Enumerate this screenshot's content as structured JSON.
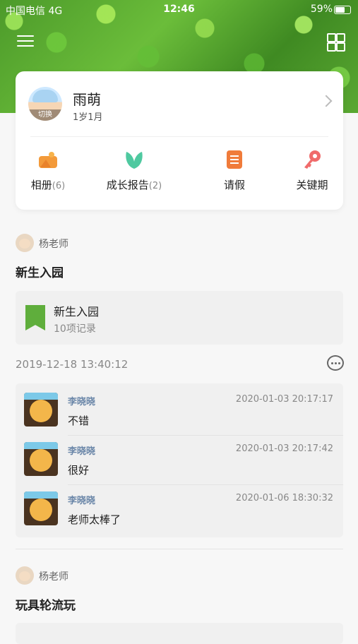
{
  "status_bar": {
    "carrier": "中国电信 4G",
    "time": "12:46",
    "battery": "59%"
  },
  "child": {
    "name": "雨萌",
    "age": "1岁1月",
    "switch_label": "切换"
  },
  "features": [
    {
      "label": "相册",
      "count": "(6)",
      "icon": "photo-album-icon",
      "color": "#f39a3a"
    },
    {
      "label": "成长报告",
      "count": "(2)",
      "icon": "growth-leaf-icon",
      "color": "#4fc9a0"
    },
    {
      "label": "请假",
      "count": "",
      "icon": "leave-document-icon",
      "color": "#f07b3a"
    },
    {
      "label": "关键期",
      "count": "",
      "icon": "key-icon",
      "color": "#f06b6b"
    }
  ],
  "posts": [
    {
      "teacher": "杨老师",
      "title": "新生入园",
      "album": {
        "title": "新生入园",
        "count": "10项记录"
      },
      "time": "2019-12-18 13:40:12",
      "comments": [
        {
          "name": "李晓晓",
          "date": "2020-01-03 20:17:17",
          "text": "不错"
        },
        {
          "name": "李晓晓",
          "date": "2020-01-03 20:17:42",
          "text": "很好"
        },
        {
          "name": "李晓晓",
          "date": "2020-01-06 18:30:32",
          "text": "老师太棒了"
        }
      ]
    },
    {
      "teacher": "杨老师",
      "title": "玩具轮流玩"
    }
  ]
}
